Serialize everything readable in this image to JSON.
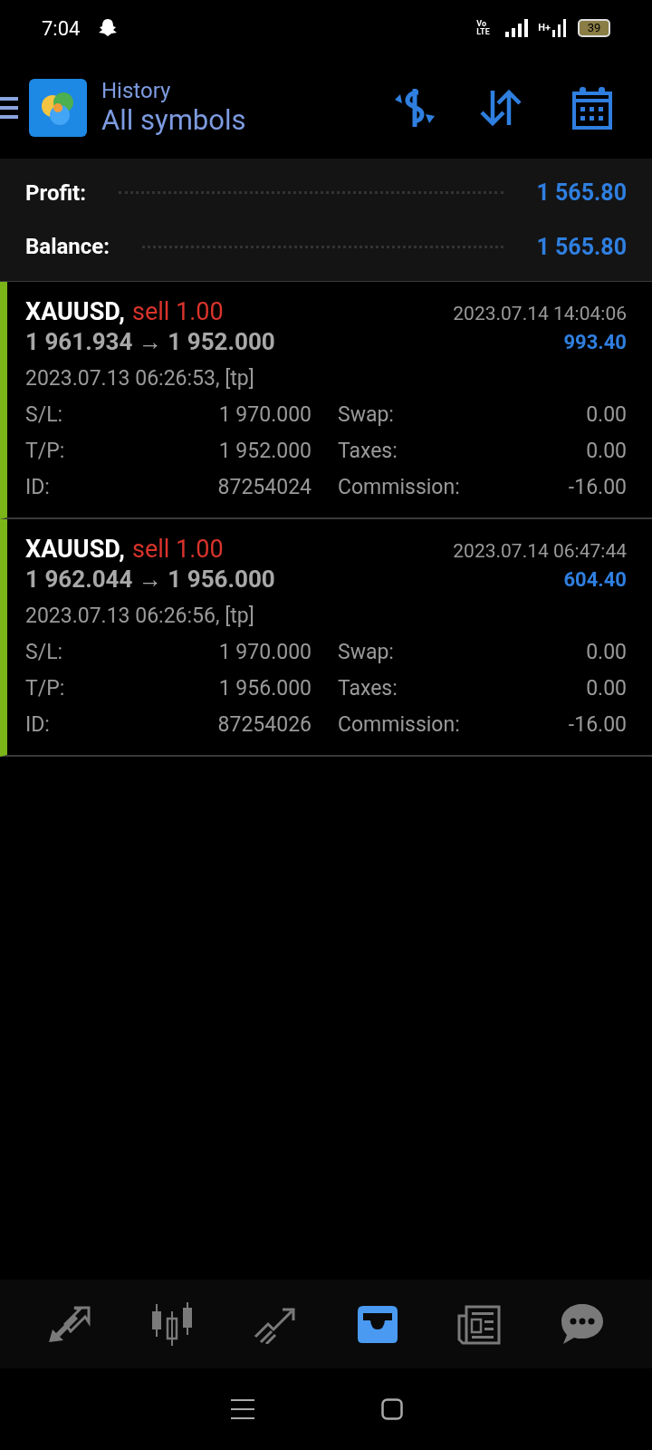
{
  "status_bar": {
    "time": "7:04",
    "volte": "Vo LTE",
    "network": "H+",
    "battery": "39"
  },
  "header": {
    "title": "History",
    "subtitle": "All symbols"
  },
  "summary": [
    {
      "label": "Profit:",
      "value": "1 565.80"
    },
    {
      "label": "Balance:",
      "value": "1 565.80"
    }
  ],
  "trades": [
    {
      "symbol": "XAUUSD,",
      "color": "#d9342b",
      "side": "sell 1.00",
      "prices": "1 961.934 → 1 952.000",
      "close_time": "2023.07.14 14:04:06",
      "profit": "993.40",
      "open_time": "2023.07.13 06:26:53, [tp]",
      "fields": [
        [
          "S/L:",
          "1 970.000",
          "Swap:",
          "0.00"
        ],
        [
          "T/P:",
          "1 952.000",
          "Taxes:",
          "0.00"
        ],
        [
          "ID:",
          "87254024",
          "Commission:",
          "-16.00"
        ]
      ]
    },
    {
      "symbol": "XAUUSD,",
      "color": "#d9342b",
      "side": "sell 1.00",
      "prices": "1 962.044 → 1 956.000",
      "close_time": "2023.07.14 06:47:44",
      "profit": "604.40",
      "open_time": "2023.07.13 06:26:56, [tp]",
      "fields": [
        [
          "S/L:",
          "1 970.000",
          "Swap:",
          "0.00"
        ],
        [
          "T/P:",
          "1 956.000",
          "Taxes:",
          "0.00"
        ],
        [
          "ID:",
          "87254026",
          "Commission:",
          "-16.00"
        ]
      ]
    }
  ],
  "bottom_nav": [
    {
      "kind": "quotes",
      "selected": false
    },
    {
      "kind": "chart",
      "selected": false
    },
    {
      "kind": "trade",
      "selected": false
    },
    {
      "kind": "history",
      "selected": true
    },
    {
      "kind": "news",
      "selected": false
    },
    {
      "kind": "chat",
      "selected": false
    }
  ]
}
